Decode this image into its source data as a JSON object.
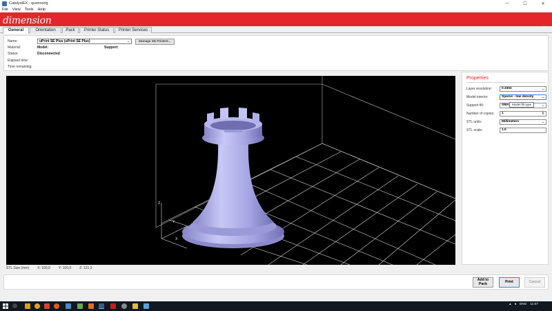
{
  "window": {
    "title": "CatalystEX - queenorig",
    "controls": {
      "minimize": "—",
      "maximize": "☐",
      "close": "✕"
    }
  },
  "menu": [
    "File",
    "View",
    "Tools",
    "Help"
  ],
  "brand": {
    "logo_text": "dimension",
    "color": "#e4262b"
  },
  "tabs": [
    {
      "label": "General",
      "active": true
    },
    {
      "label": "Orientation",
      "active": false
    },
    {
      "label": "Pack",
      "active": false
    },
    {
      "label": "Printer Status",
      "active": false
    },
    {
      "label": "Printer Services",
      "active": false
    }
  ],
  "info": {
    "name_label": "Name:",
    "printer_selected": "uPrint SE Plus (uPrint SE Plus)",
    "manage_button": "Manage 3D Printers...",
    "material_label": "Material:",
    "model_label": "Model:",
    "support_label": "Support:",
    "status_label": "Status:",
    "status_value": "Disconnected",
    "elapsed_label": "Elapsed time:",
    "remaining_label": "Time remaining:"
  },
  "viewport": {
    "background": "#000000",
    "model_color": "#a8a8e8",
    "grid_color": "#d8d8d8",
    "axis_labels": {
      "x": "X",
      "y": "Y",
      "z": "Z"
    }
  },
  "stl_size": {
    "label": "STL Size (mm)",
    "x": "X: 100,0",
    "y": "Y: 100,0",
    "z": "Z: 121,3"
  },
  "properties": {
    "heading": "Properties",
    "layer_resolution_label": "Layer resolution:",
    "layer_resolution_value": "0.3302",
    "model_interior_label": "Model interior:",
    "model_interior_value": "Sparse - low density",
    "support_fill_label": "Support fill:",
    "support_fill_value": "SMART",
    "copies_label": "Number of copies:",
    "copies_value": "1",
    "stl_units_label": "STL units:",
    "stl_units_value": "Millimeters",
    "stl_scale_label": "STL scale:",
    "stl_scale_value": "1.0",
    "tooltip": "Model fill type"
  },
  "actions": {
    "add_to_pack": "Add to\nPack",
    "print": "Print",
    "cancel": "Cancel"
  },
  "taskbar": {
    "language": "ENG",
    "time": "11:07"
  }
}
